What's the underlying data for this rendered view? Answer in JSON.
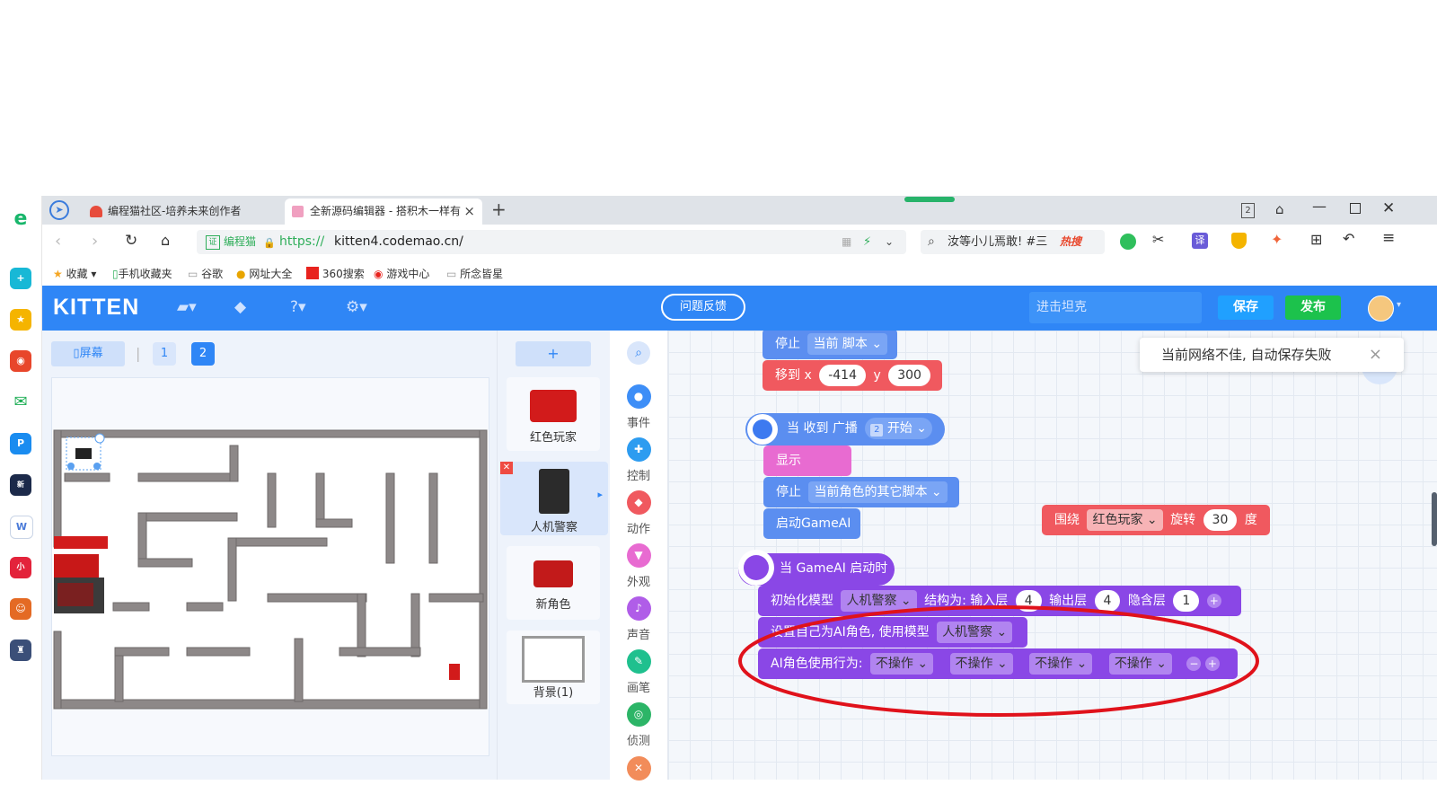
{
  "browser": {
    "tabs": [
      {
        "title": "编程猫社区-培养未来创作者"
      },
      {
        "title": "全新源码编辑器 - 搭积木一样有"
      }
    ],
    "tab_close": "×",
    "new_tab": "+",
    "tab_counter": "2",
    "url_label": "编程猫",
    "url_scheme": "https://",
    "url_rest": "kitten4.codemao.cn/",
    "search_text": "汝等小儿焉敢! #三",
    "hot_label": "热搜",
    "translate_label": "译",
    "bookmarks": [
      "收藏",
      "手机收藏夹",
      "谷歌",
      "网址大全",
      "360搜索",
      "游戏中心",
      "所念皆星"
    ]
  },
  "app": {
    "logo": "KITTEN",
    "feedback": "问题反馈",
    "project_name": "进击坦克",
    "save": "保存",
    "publish": "发布",
    "colors": {
      "header": "#2f86f6",
      "save": "#20a0ff",
      "publish": "#1cc24c"
    }
  },
  "stage": {
    "screen_label": "屏幕",
    "pages": [
      "1",
      "2"
    ],
    "active_page": "2"
  },
  "sprites": {
    "add": "+",
    "items": [
      {
        "name": "红色玩家"
      },
      {
        "name": "人机警察",
        "selected": true
      },
      {
        "name": "新角色"
      },
      {
        "name": "背景(1)"
      }
    ]
  },
  "categories": [
    {
      "label": "事件",
      "color": "#3d8ef7"
    },
    {
      "label": "控制",
      "color": "#2d9cf0"
    },
    {
      "label": "动作",
      "color": "#f0595f"
    },
    {
      "label": "外观",
      "color": "#e86bd1"
    },
    {
      "label": "声音",
      "color": "#b05de8"
    },
    {
      "label": "画笔",
      "color": "#1fc08e"
    },
    {
      "label": "侦测",
      "color": "#2cb567"
    }
  ],
  "blocks": {
    "stop1": {
      "label": "停止",
      "value": "当前 脚本"
    },
    "move": {
      "label": "移到 x",
      "x": "-414",
      "y_label": "y",
      "y": "300"
    },
    "receive": {
      "label": "当 收到 广播",
      "badge": "2",
      "value": "开始"
    },
    "show": {
      "label": "显示"
    },
    "stop2": {
      "label": "停止",
      "value": "当前角色的其它脚本"
    },
    "start_ai": {
      "label": "启动GameAI"
    },
    "rotate": {
      "label": "围绕",
      "target": "红色玩家",
      "action": "旋转",
      "deg": "30",
      "unit": "度"
    },
    "ai_start": {
      "label": "当 GameAI 启动时"
    },
    "init": {
      "label": "初始化模型",
      "model": "人机警察",
      "struct": "结构为: 输入层",
      "in": "4",
      "out_label": "输出层",
      "out": "4",
      "hidden_label": "隐含层",
      "hidden": "1"
    },
    "set_self": {
      "label": "设置自己为AI角色, 使用模型",
      "model": "人机警察"
    },
    "behavior": {
      "label": "AI角色使用行为:",
      "options": [
        "不操作",
        "不操作",
        "不操作",
        "不操作"
      ]
    }
  },
  "toast": {
    "message": "当前网络不佳, 自动保存失败",
    "close": "×"
  }
}
